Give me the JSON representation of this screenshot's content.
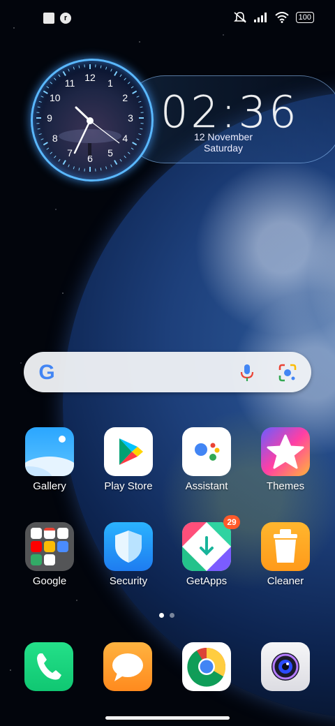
{
  "status_bar": {
    "notification_icons": [
      "square-notification-icon",
      "r-app-notification-icon"
    ],
    "notification_glyph": "r",
    "system_icons": [
      "silent-mode-icon",
      "signal-icon",
      "wifi-icon",
      "battery-icon"
    ],
    "battery": "100"
  },
  "clock_widget": {
    "analog_numbers": [
      "12",
      "1",
      "2",
      "3",
      "4",
      "5",
      "6",
      "7",
      "8",
      "9",
      "10",
      "11"
    ],
    "time": "02:36",
    "date": "12 November",
    "weekday": "Saturday"
  },
  "search": {
    "google_letter": "G",
    "icons": [
      "google-g-icon",
      "mic-icon",
      "lens-icon"
    ]
  },
  "apps_row1": [
    {
      "label": "Gallery",
      "icon": "gallery-icon"
    },
    {
      "label": "Play Store",
      "icon": "play-store-icon"
    },
    {
      "label": "Assistant",
      "icon": "assistant-icon"
    },
    {
      "label": "Themes",
      "icon": "themes-icon"
    }
  ],
  "apps_row2": [
    {
      "label": "Google",
      "icon": "google-folder-icon"
    },
    {
      "label": "Security",
      "icon": "security-icon"
    },
    {
      "label": "GetApps",
      "icon": "getapps-icon",
      "badge": "29"
    },
    {
      "label": "Cleaner",
      "icon": "cleaner-icon"
    }
  ],
  "dock": [
    {
      "icon": "phone-icon"
    },
    {
      "icon": "messages-icon"
    },
    {
      "icon": "chrome-icon"
    },
    {
      "icon": "camera-icon"
    }
  ],
  "pages": {
    "count": 2,
    "active": 1
  },
  "colors": {
    "clock_glow": "#5ab8ff",
    "badge": "#ff5a2a",
    "search_bg": "#f0f2f6"
  }
}
